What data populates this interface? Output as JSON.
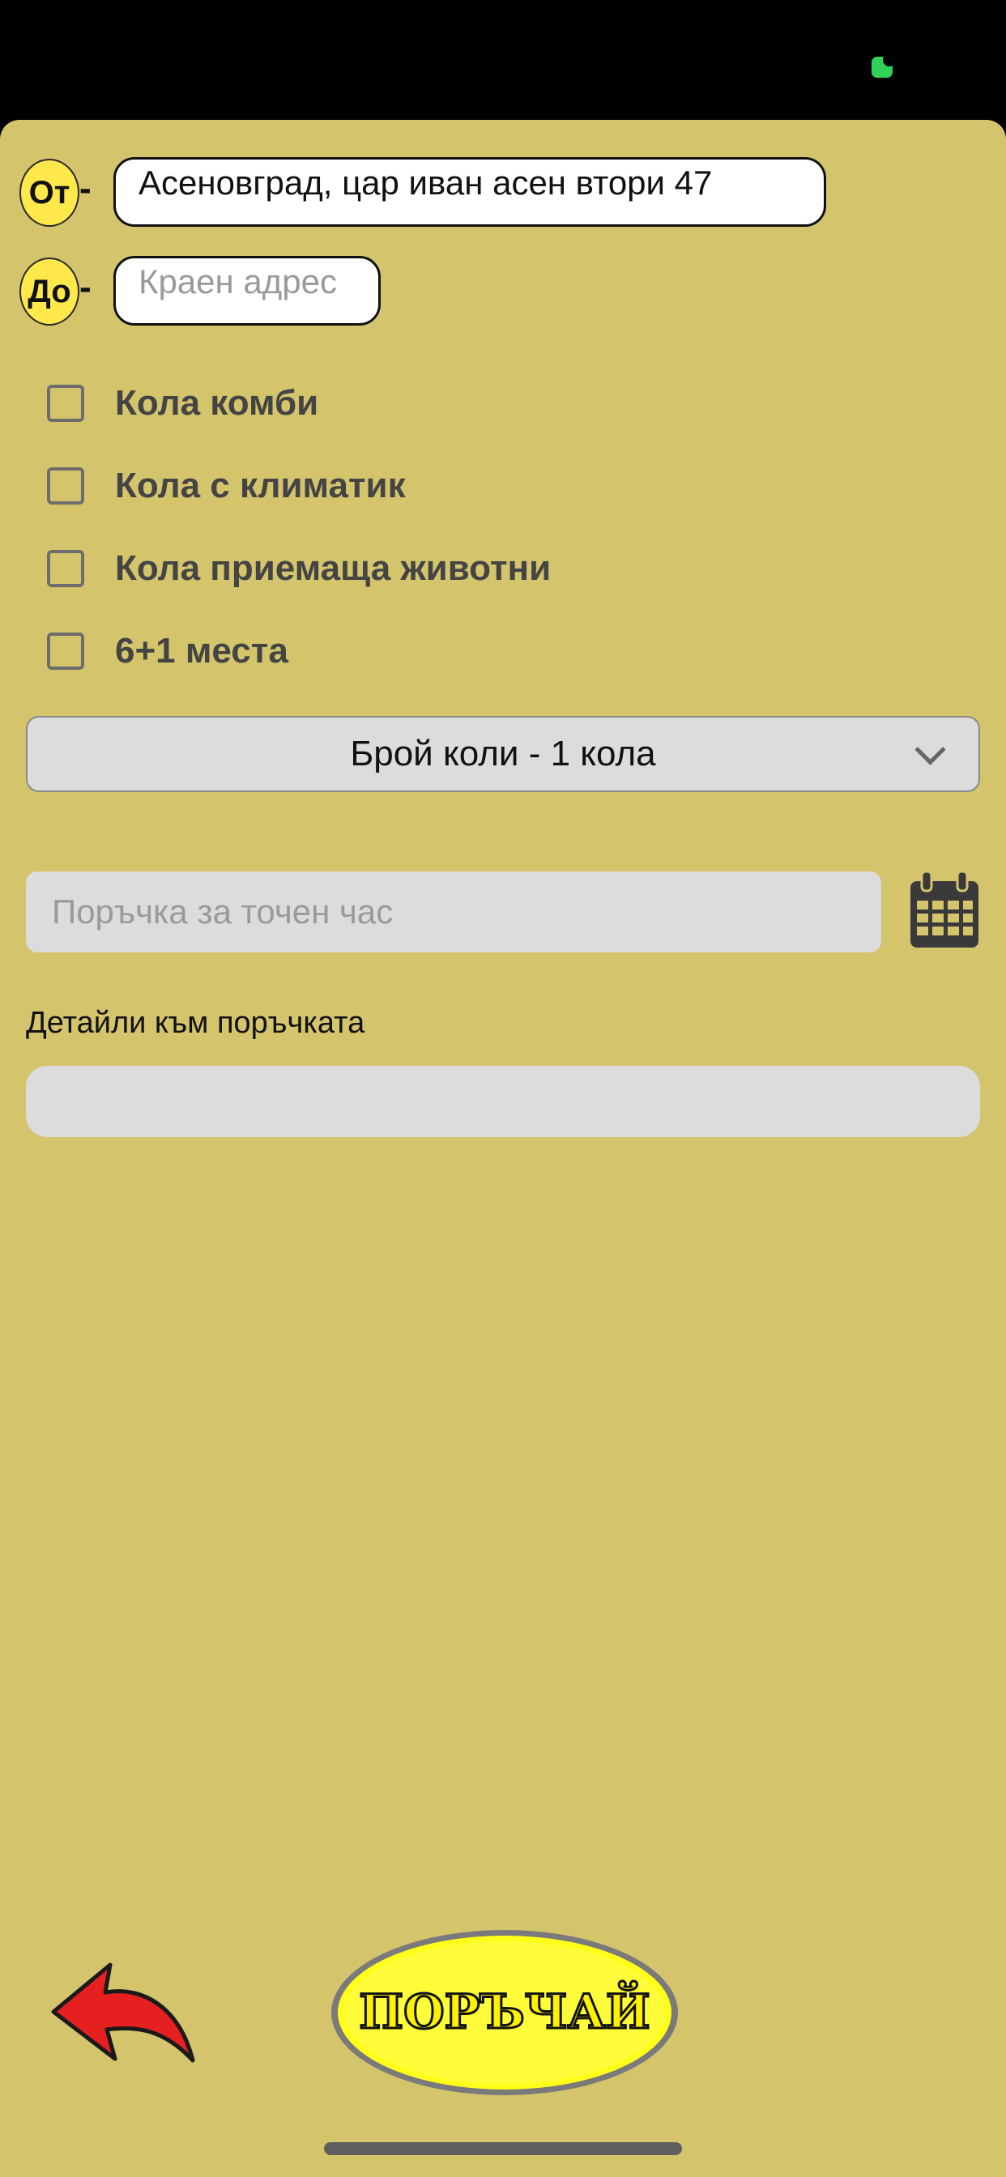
{
  "form": {
    "from": {
      "badge": "От",
      "dash": "-",
      "value": "Асеновград, цар иван асен втори 47"
    },
    "to": {
      "badge": "До",
      "dash": "-",
      "placeholder": "Краен адрес"
    },
    "options": [
      {
        "label": "Кола комби",
        "checked": false
      },
      {
        "label": "Кола с климатик",
        "checked": false
      },
      {
        "label": "Кола приемаща животни",
        "checked": false
      },
      {
        "label": "6+1 места",
        "checked": false
      }
    ],
    "car_count_selected": "Брой коли - 1 кола",
    "time_placeholder": "Поръчка за точен час",
    "details_label": "Детайли към поръчката",
    "details_value": ""
  },
  "actions": {
    "order_label": "ПОРЪЧАЙ",
    "back_icon": "back-arrow-icon",
    "calendar_icon": "calendar-icon"
  },
  "colors": {
    "background": "#d4c46c",
    "badge": "#ffe94a",
    "order_button": "#ffff1a",
    "back_arrow": "#e62020",
    "status_indicator": "#2fd158"
  }
}
